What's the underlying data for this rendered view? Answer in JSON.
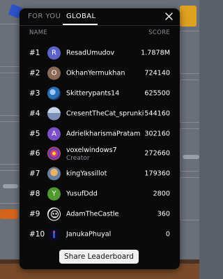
{
  "tabs": {
    "for_you": "FOR YOU",
    "global": "GLOBAL",
    "active": "global"
  },
  "columns": {
    "name": "NAME",
    "score": "SCORE"
  },
  "share_label": "Share Leaderboard",
  "colors": {
    "modal_bg": "#0a0a0b",
    "muted": "#8c8f96",
    "button_bg": "#f1f1f4"
  },
  "rows": [
    {
      "rank": "#1",
      "name": "ResadUmudov",
      "score": "1.7878M",
      "avatar_letter": "R",
      "avatar_color": "#5b63c8",
      "avatar_icon": "letter-avatar"
    },
    {
      "rank": "#2",
      "name": "OkhanYermukhan",
      "score": "724140",
      "avatar_letter": "O",
      "avatar_color": "#8a6a55",
      "avatar_icon": "letter-avatar"
    },
    {
      "rank": "#3",
      "name": "Skitterypants14",
      "score": "625500",
      "avatar_letter": "",
      "avatar_color": "#2b6fb3",
      "avatar_icon": "blue-pattern-avatar"
    },
    {
      "rank": "#4",
      "name": "CresentTheCat_sprunki",
      "score": "544160",
      "avatar_letter": "",
      "avatar_color": "#9aa7c8",
      "avatar_icon": "cat-avatar"
    },
    {
      "rank": "#5",
      "name": "AdrielkharismaPratam",
      "score": "302160",
      "avatar_letter": "A",
      "avatar_color": "#7b4fc7",
      "avatar_icon": "letter-avatar"
    },
    {
      "rank": "#6",
      "name": "voxelwindows7",
      "subtitle": "Creator",
      "score": "272660",
      "avatar_letter": "",
      "avatar_color": "#c0306a",
      "avatar_icon": "colorful-pattern-avatar"
    },
    {
      "rank": "#7",
      "name": "kingYassillot",
      "score": "179360",
      "avatar_letter": "",
      "avatar_color": "#b08a3c",
      "avatar_icon": "character-avatar"
    },
    {
      "rank": "#8",
      "name": "YusufDdd",
      "score": "2800",
      "avatar_letter": "Y",
      "avatar_color": "#4e9a2e",
      "avatar_icon": "letter-avatar"
    },
    {
      "rank": "#9",
      "name": "AdamTheCastle",
      "score": "360",
      "avatar_letter": "",
      "avatar_color": "#ffffff",
      "avatar_icon": "skull-avatar"
    },
    {
      "rank": "#10",
      "name": "JanukaPhuyal",
      "score": "0",
      "avatar_letter": "",
      "avatar_color": "#0a0a20",
      "avatar_icon": "dark-avatar"
    }
  ]
}
